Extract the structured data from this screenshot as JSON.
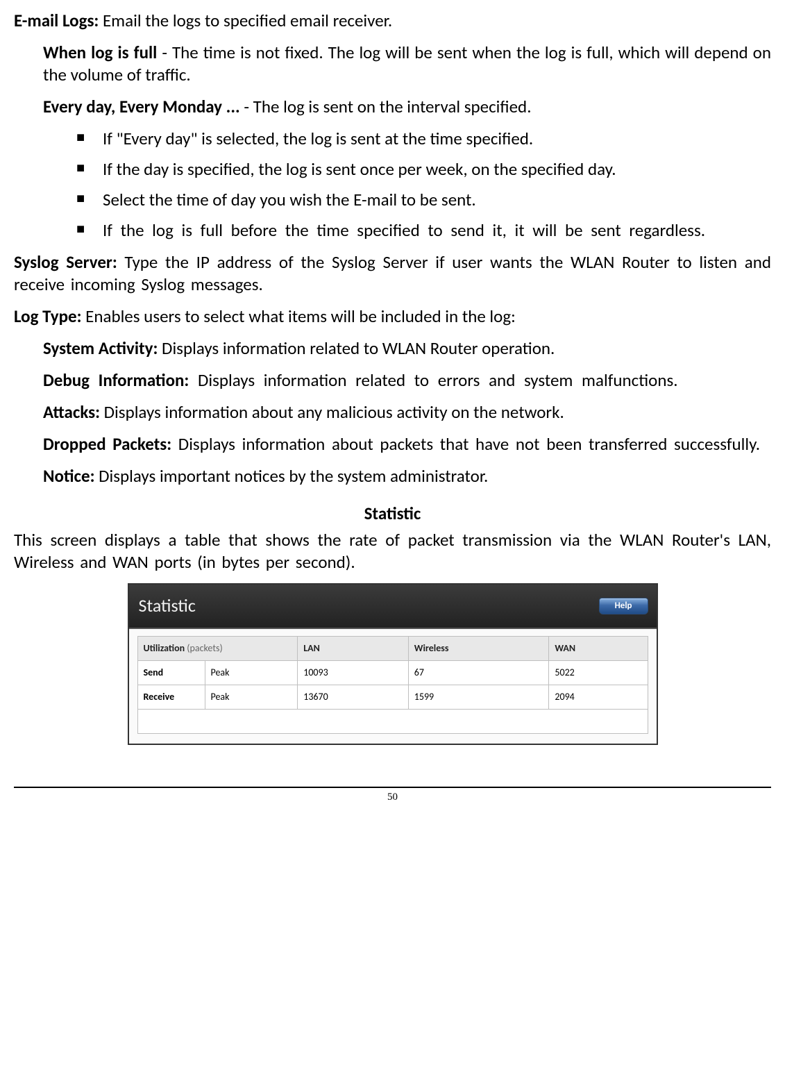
{
  "para1_bold": "E-mail Logs:",
  "para1_rest": " Email the logs to specified email receiver.",
  "para2_bold": "When log is full",
  "para2_rest": " - The time is not fixed. The log will be sent when the log is full, which will depend on the volume of traffic.",
  "para3_bold": "Every day, Every Monday ...",
  "para3_rest": "  - The log is sent on the interval specified.",
  "bullets": [
    "If \"Every day\" is selected, the log is sent at the time specified.",
    "If the day is specified, the log is sent once per week, on the specified day.",
    "Select the time of day you wish the E-mail to be sent.",
    "If the log is full before the time specified to send it, it will be sent regardless."
  ],
  "para4_bold": "Syslog Server:",
  "para4_rest": " Type the IP address of the Syslog Server if user wants the WLAN Router to listen and receive incoming Syslog messages.",
  "para5_bold": "Log Type:",
  "para5_rest": " Enables users to select what items will be included in the log:",
  "para6_bold": "System Activity:",
  "para6_rest": " Displays information related to WLAN Router operation.",
  "para7_bold": "Debug Information:",
  "para7_rest": " Displays information related to errors and system malfunctions.",
  "para8_bold": "Attacks:",
  "para8_rest": " Displays information about any malicious activity on the network.",
  "para9_bold": "Dropped Packets:",
  "para9_rest": " Displays information about packets that have not been transferred successfully.",
  "para10_bold": "Notice:",
  "para10_rest": " Displays important notices by the system administrator.",
  "section_head": "Statistic",
  "stat_desc": "This screen displays a table that shows the rate of packet transmission via the WLAN Router's LAN, Wireless and WAN ports (in bytes per second).",
  "stat_title": "Statistic",
  "help_label": "Help",
  "chart_data": {
    "type": "table",
    "headers": {
      "util_main": "Utilization",
      "util_sub": "(packets)",
      "lan": "LAN",
      "wireless": "Wireless",
      "wan": "WAN"
    },
    "rows": [
      {
        "label": "Send",
        "sublabel": "Peak",
        "lan": "10093",
        "wireless": "67",
        "wan": "5022"
      },
      {
        "label": "Receive",
        "sublabel": "Peak",
        "lan": "13670",
        "wireless": "1599",
        "wan": "2094"
      }
    ]
  },
  "page_number": "50"
}
